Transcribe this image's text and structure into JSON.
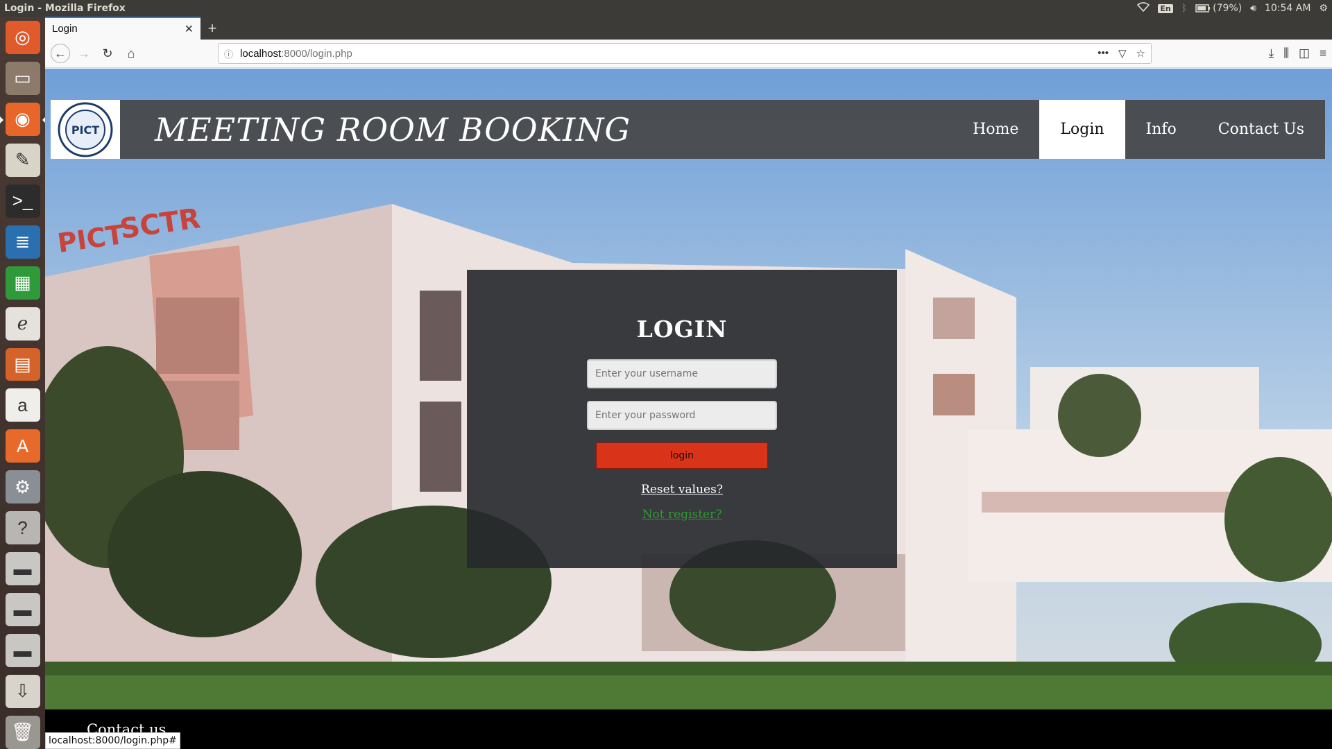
{
  "window": {
    "title": "Login - Mozilla Firefox"
  },
  "system_tray": {
    "lang": "En",
    "battery": "(79%)",
    "time": "10:54 AM",
    "icons": [
      "wifi-icon",
      "keyboard-layout-icon",
      "bluetooth-icon",
      "battery-icon",
      "volume-icon",
      "settings-gear-icon"
    ]
  },
  "launcher": {
    "items": [
      {
        "name": "ubuntu-dash-icon",
        "glyph": "◎",
        "bg": "#e05a2b"
      },
      {
        "name": "files-icon",
        "glyph": "▭",
        "bg": "#8c7a6b"
      },
      {
        "name": "firefox-icon",
        "glyph": "◉",
        "bg": "#e8662a"
      },
      {
        "name": "text-editor-icon",
        "glyph": "✎",
        "bg": "#d8d4c8"
      },
      {
        "name": "terminal-icon",
        "glyph": ">_",
        "bg": "#2c2c2c"
      },
      {
        "name": "writer-icon",
        "glyph": "≣",
        "bg": "#2a6fb0"
      },
      {
        "name": "calc-icon",
        "glyph": "▦",
        "bg": "#2f9a3a"
      },
      {
        "name": "document-viewer-icon",
        "glyph": "ℯ",
        "bg": "#e5e1dc"
      },
      {
        "name": "impress-icon",
        "glyph": "▤",
        "bg": "#d3622b"
      },
      {
        "name": "amazon-icon",
        "glyph": "a",
        "bg": "#f0eeea"
      },
      {
        "name": "software-center-icon",
        "glyph": "A",
        "bg": "#e86a2a"
      },
      {
        "name": "system-settings-icon",
        "glyph": "⚙",
        "bg": "#8a8f96"
      },
      {
        "name": "help-icon",
        "glyph": "?",
        "bg": "#b8b6b2"
      },
      {
        "name": "drive-icon",
        "glyph": "▬",
        "bg": "#c9c7c3"
      },
      {
        "name": "drive-icon",
        "glyph": "▬",
        "bg": "#c9c7c3"
      },
      {
        "name": "drive-icon",
        "glyph": "▬",
        "bg": "#c9c7c3"
      },
      {
        "name": "installer-icon",
        "glyph": "⇩",
        "bg": "#d8d4cc"
      },
      {
        "name": "trash-icon",
        "glyph": "🗑",
        "bg": "#9a9690"
      }
    ]
  },
  "browser": {
    "tab_title": "Login",
    "url_host": "localhost",
    "url_path": ":8000/login.php",
    "status_url": "localhost:8000/login.php#"
  },
  "page": {
    "logo_text": "PICT",
    "site_title": "MEETING ROOM BOOKING",
    "menu": [
      {
        "label": "Home",
        "active": false
      },
      {
        "label": "Login",
        "active": true
      },
      {
        "label": "Info",
        "active": false
      },
      {
        "label": "Contact Us",
        "active": false
      }
    ],
    "login": {
      "heading": "LOGIN",
      "username_placeholder": "Enter your username",
      "password_placeholder": "Enter your password",
      "button_label": "login",
      "reset_link": "Reset values?",
      "register_link": "Not register?"
    },
    "building_signs": [
      "PICT",
      "SCTR"
    ],
    "footer_text": "Contact us"
  }
}
